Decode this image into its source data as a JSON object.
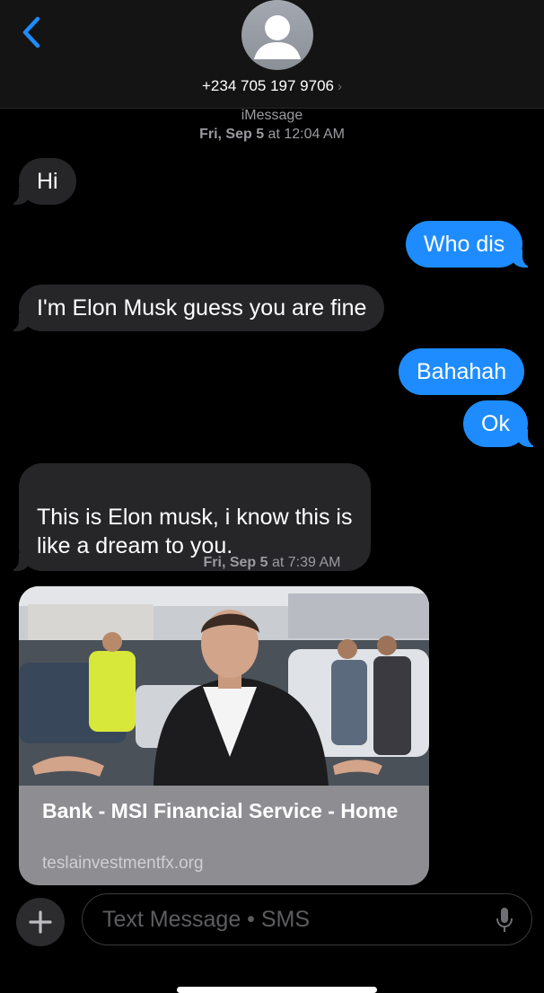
{
  "header": {
    "contact": "+234 705 197 9706",
    "back_icon": "chevron-left-icon",
    "avatar_icon": "person-icon",
    "accent": "#1e8cff"
  },
  "thread": {
    "service": "iMessage",
    "timestamp1_day": "Fri, Sep 5",
    "timestamp1_time": "at 12:04 AM",
    "timestamp2_day": "Fri, Sep 5",
    "timestamp2_time": "at 7:39 AM"
  },
  "messages": [
    {
      "from": "them",
      "text": "Hi"
    },
    {
      "from": "me",
      "text": "Who dis"
    },
    {
      "from": "them",
      "text": "I'm Elon Musk guess you are fine"
    },
    {
      "from": "me",
      "text": "Bahahah"
    },
    {
      "from": "me",
      "text": "Ok"
    },
    {
      "from": "them",
      "text": "This is Elon musk, i know this is\nlike a dream to you."
    }
  ],
  "link_preview": {
    "title": "Bank - MSI Financial Service - Home",
    "domain": "teslainvestmentfx.org"
  },
  "composer": {
    "placeholder": "Text Message • SMS",
    "plus_icon": "plus-icon",
    "mic_icon": "microphone-icon"
  }
}
